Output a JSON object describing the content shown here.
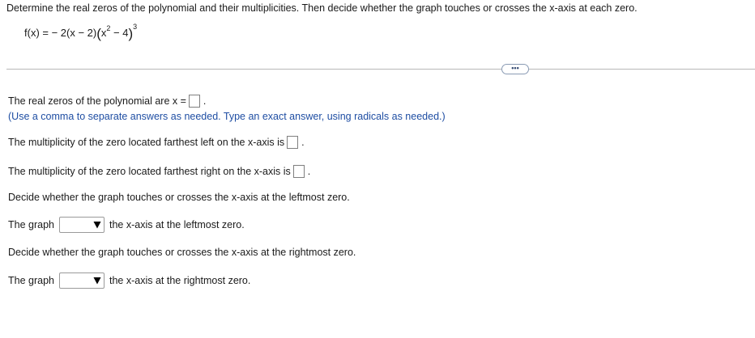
{
  "question": "Determine the real zeros of the polynomial and their multiplicities. Then decide whether the graph touches or crosses the x-axis at each zero.",
  "formula": {
    "lhs": "f(x) = ",
    "coef": "− 2",
    "factor1": "(x − 2)",
    "factor2_base": "x",
    "factor2_exp": "2",
    "factor2_rest": " − 4",
    "outer_exp": "3"
  },
  "more_button_label": "•••",
  "zeros": {
    "label": "The real zeros of the polynomial are x =",
    "hint": "(Use a comma to separate answers as needed. Type an exact answer, using radicals as needed.)"
  },
  "mult_left": {
    "label": "The multiplicity of the zero located farthest left on the x-axis is"
  },
  "mult_right": {
    "label": "The multiplicity of the zero located farthest right on the x-axis is"
  },
  "decide_left": "Decide whether the graph touches or crosses the x-axis at the leftmost zero.",
  "graph_left": {
    "prefix": "The graph",
    "suffix": "the x-axis at the leftmost zero."
  },
  "decide_right": "Decide whether the graph touches or crosses the x-axis at the rightmost zero.",
  "graph_right": {
    "prefix": "The graph",
    "suffix": "the x-axis at the rightmost zero."
  },
  "period": "."
}
